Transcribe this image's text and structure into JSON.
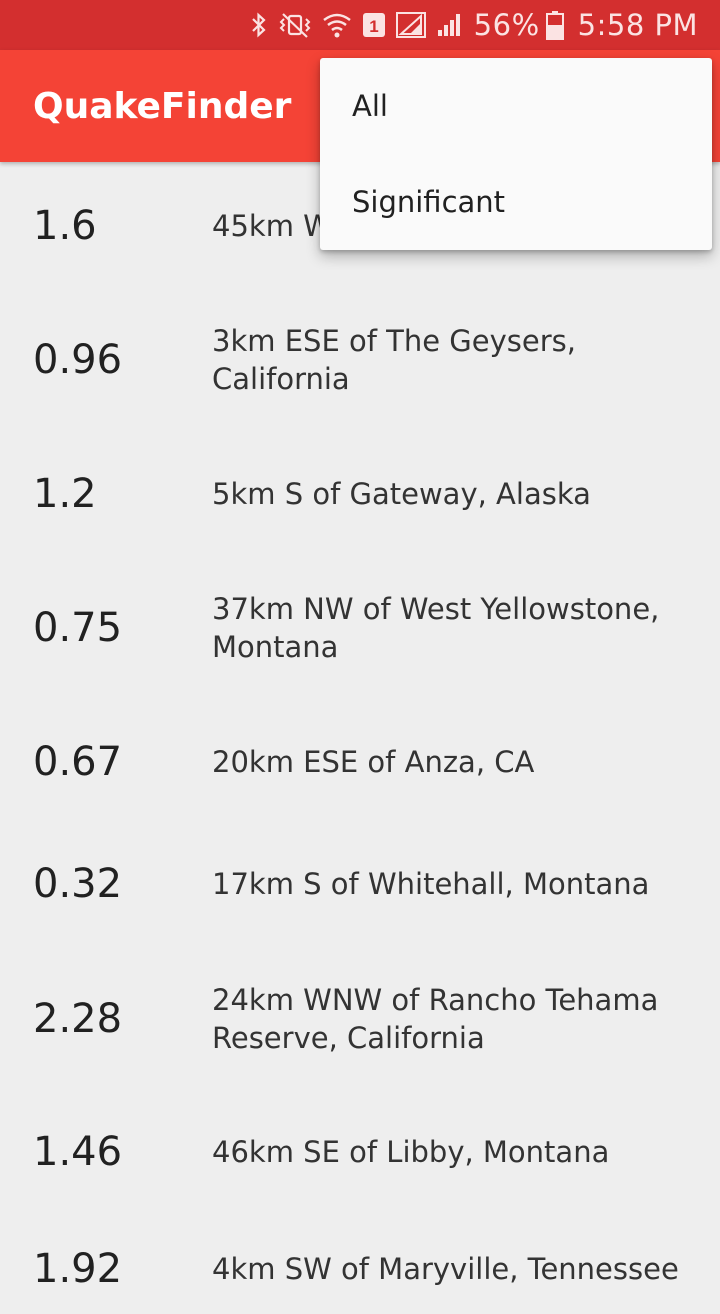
{
  "status_bar": {
    "battery": "56%",
    "time": "5:58 PM",
    "sim_badge": "1",
    "icons": [
      "bluetooth-icon",
      "vibrate-icon",
      "wifi-icon",
      "sim-1-icon",
      "signal-icon",
      "signal-icon",
      "battery-icon"
    ]
  },
  "app_bar": {
    "title": "QuakeFinder",
    "color": "#f44336"
  },
  "overflow_menu": {
    "items": [
      "All",
      "Significant"
    ]
  },
  "earthquakes": [
    {
      "mag": "1.6",
      "place": "45km W"
    },
    {
      "mag": "0.96",
      "place": "3km ESE of The Geysers, California"
    },
    {
      "mag": "1.2",
      "place": "5km S of Gateway, Alaska"
    },
    {
      "mag": "0.75",
      "place": "37km NW of West Yellowstone, Montana"
    },
    {
      "mag": "0.67",
      "place": "20km ESE of Anza, CA"
    },
    {
      "mag": "0.32",
      "place": "17km S of Whitehall, Montana"
    },
    {
      "mag": "2.28",
      "place": "24km WNW of Rancho Tehama Reserve, California"
    },
    {
      "mag": "1.46",
      "place": "46km SE of Libby, Montana"
    },
    {
      "mag": "1.92",
      "place": "4km SW of Maryville, Tennessee"
    }
  ]
}
